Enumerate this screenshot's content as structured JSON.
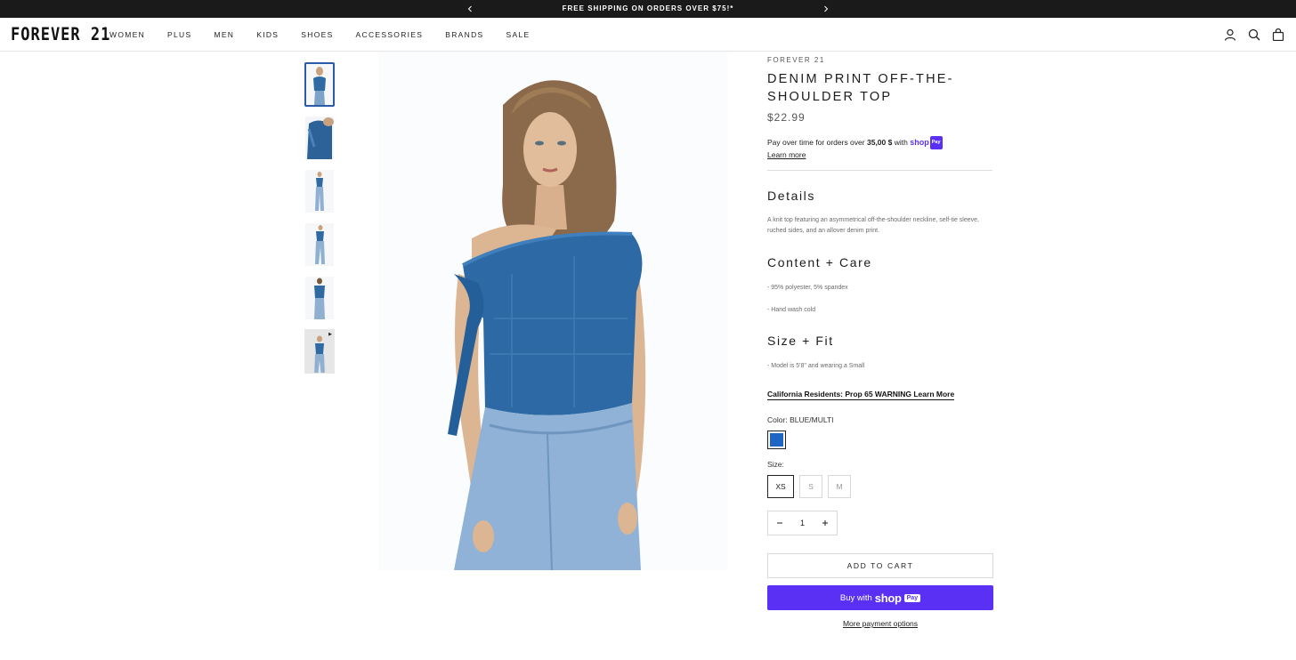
{
  "announcement": {
    "text": "FREE SHIPPING ON ORDERS OVER $75!*"
  },
  "header": {
    "logo": "FOREVER 21",
    "nav": [
      "WOMEN",
      "PLUS",
      "MEN",
      "KIDS",
      "SHOES",
      "ACCESSORIES",
      "BRANDS",
      "SALE"
    ],
    "icons": [
      "account-icon",
      "search-icon",
      "bag-icon"
    ]
  },
  "gallery": {
    "thumbnail_count": 6,
    "active_index": 0,
    "last_is_video": true
  },
  "product": {
    "brand": "FOREVER 21",
    "title": "DENIM PRINT OFF-THE-SHOULDER TOP",
    "price": "$22.99",
    "installments": {
      "prefix": "Pay over time for orders over",
      "amount": "35,00 $",
      "suffix": "with",
      "provider": "shop",
      "provider_badge": "Pay",
      "learn_more": "Learn more"
    },
    "details": {
      "title": "Details",
      "text": "A knit top featuring an asymmetrical off-the-shoulder neckline, self-tie sleeve, ruched sides, and an allover denim print."
    },
    "content_care": {
      "title": "Content + Care",
      "lines": [
        "- 95% polyester, 5% spandex",
        "- Hand wash cold"
      ]
    },
    "size_fit": {
      "title": "Size + Fit",
      "lines": [
        "- Model is 5'8\" and wearing a Small"
      ]
    },
    "prop65": "California Residents: Prop 65 WARNING Learn More",
    "color": {
      "label": "Color:",
      "value": "BLUE/MULTI",
      "swatch_color": "#1f66c4"
    },
    "size": {
      "label": "Size:",
      "options": [
        "XS",
        "S",
        "M"
      ],
      "selected": "XS"
    },
    "quantity": {
      "value": "1",
      "minus": "−",
      "plus": "+"
    },
    "add_to_cart": "ADD TO CART",
    "shop_pay": {
      "prefix": "Buy with",
      "brand": "shop",
      "badge": "Pay",
      "color": "#5a31f4"
    },
    "more_payment": "More payment options"
  }
}
